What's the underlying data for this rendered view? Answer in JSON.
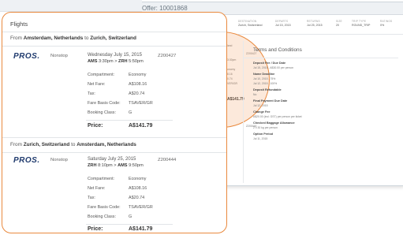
{
  "window": {
    "title": "Offer: 10001868"
  },
  "summary": [
    {
      "h": "DESTINATION",
      "v": "Zurich, Switzerland"
    },
    {
      "h": "DEPARTS",
      "v": "Jul 15, 2015"
    },
    {
      "h": "RETURNS",
      "v": "Jul 25, 2015"
    },
    {
      "h": "SIZE",
      "v": "20"
    },
    {
      "h": "TRIP TYPE",
      "v": "ROUND_TRIP"
    },
    {
      "h": "RATINGS",
      "v": "0%"
    }
  ],
  "terms": {
    "title": "Terms and Conditions",
    "items": [
      {
        "label": "Deposit Fee / Due Date",
        "value": "Jul 15, 2015 - A$30.00 per person"
      },
      {
        "label": "Name Deadline",
        "value": "Jul 10, 2015 - 75%"
      },
      {
        "label": "",
        "value": "Jul 12, 2015 - 100%"
      },
      {
        "label": "Deposit Refundable",
        "value": "No"
      },
      {
        "label": "Final Payment Due Date",
        "value": "Jul 12, 2015"
      },
      {
        "label": "Change Fee",
        "value": "A$20.00 (incl. GST) per person per ticket"
      },
      {
        "label": "Checked Baggage Allowance",
        "value": "2 x 30 kg per person"
      },
      {
        "label": "Option Period",
        "value": "Jul 11, 2015"
      }
    ]
  },
  "mid_fragments": [
    "land",
    "Z200427",
    "3:30pm",
    "onomy",
    "8.16",
    "0.74",
    "VER/GR",
    "A$141.79",
    "Z200444"
  ],
  "card": {
    "title": "Flights",
    "outbound": {
      "from_word": "From",
      "from": "Amsterdam, Netherlands",
      "to_word": "to",
      "to": "Zurich, Switzerland",
      "airline": "PROS.",
      "stops": "Nonstop",
      "date": "Wednesday July 15, 2015",
      "flight": "Z200427",
      "route_from": "AMS",
      "dep": "3:30pm",
      "route_to": "ZRH",
      "arr": "5:50pm",
      "rows": [
        [
          "Compartment:",
          "Economy"
        ],
        [
          "Net Fare:",
          "A$108.16"
        ],
        [
          "Tax:",
          "A$20.74"
        ],
        [
          "Fare Basis Code:",
          "TSAVER/GR"
        ],
        [
          "Booking Class:",
          "G"
        ]
      ],
      "price_label": "Price:",
      "price": "A$141.79"
    },
    "inbound": {
      "from_word": "From",
      "from": "Zurich, Switzerland",
      "to_word": "to",
      "to": "Amsterdam, Netherlands",
      "airline": "PROS.",
      "stops": "Nonstop",
      "date": "Saturday July 25, 2015",
      "flight": "Z200444",
      "route_from": "ZRH",
      "dep": "8:10pm",
      "route_to": "AMS",
      "arr": "9:50pm",
      "rows": [
        [
          "Compartment:",
          "Economy"
        ],
        [
          "Net Fare:",
          "A$108.16"
        ],
        [
          "Tax:",
          "A$20.74"
        ],
        [
          "Fare Basis Code:",
          "TSAVER/GR"
        ],
        [
          "Booking Class:",
          "G"
        ]
      ],
      "price_label": "Price:",
      "price": "A$141.79"
    }
  },
  "colors": {
    "accent": "#e9893e",
    "logo": "#1f3a6d"
  }
}
